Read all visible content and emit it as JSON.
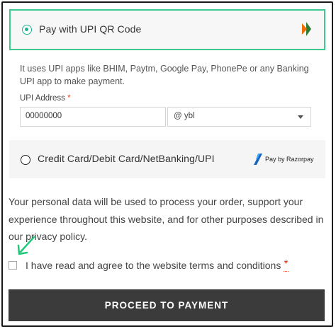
{
  "payment_options": {
    "upi_qr": {
      "title": "Pay with UPI QR Code",
      "selected": true,
      "icon": "bhim-logo-icon",
      "description": "It uses UPI apps like BHIM, Paytm, Google Pay, PhonePe or any Banking UPI app to make payment.",
      "upi_address": {
        "label": "UPI Address",
        "required_marker": "*",
        "value": "00000000",
        "handle_selected": "@ ybl"
      }
    },
    "card": {
      "title": "Credit Card/Debit Card/NetBanking/UPI",
      "selected": false,
      "icon": "razorpay-logo-icon",
      "provider_text": "Pay by Razorpay"
    }
  },
  "privacy_text": "Your personal data will be used to process your order, support your experience throughout this website, and for other purposes described in our privacy policy.",
  "terms": {
    "label": "I have read and agree to the website terms and conditions",
    "required_marker": "*",
    "checked": false
  },
  "proceed_label": "PROCEED TO PAYMENT",
  "colors": {
    "selected_border": "#3ec98f",
    "annotation_arrow": "#22c97a",
    "button_bg": "#3b3b3b",
    "required": "#e2401c"
  }
}
